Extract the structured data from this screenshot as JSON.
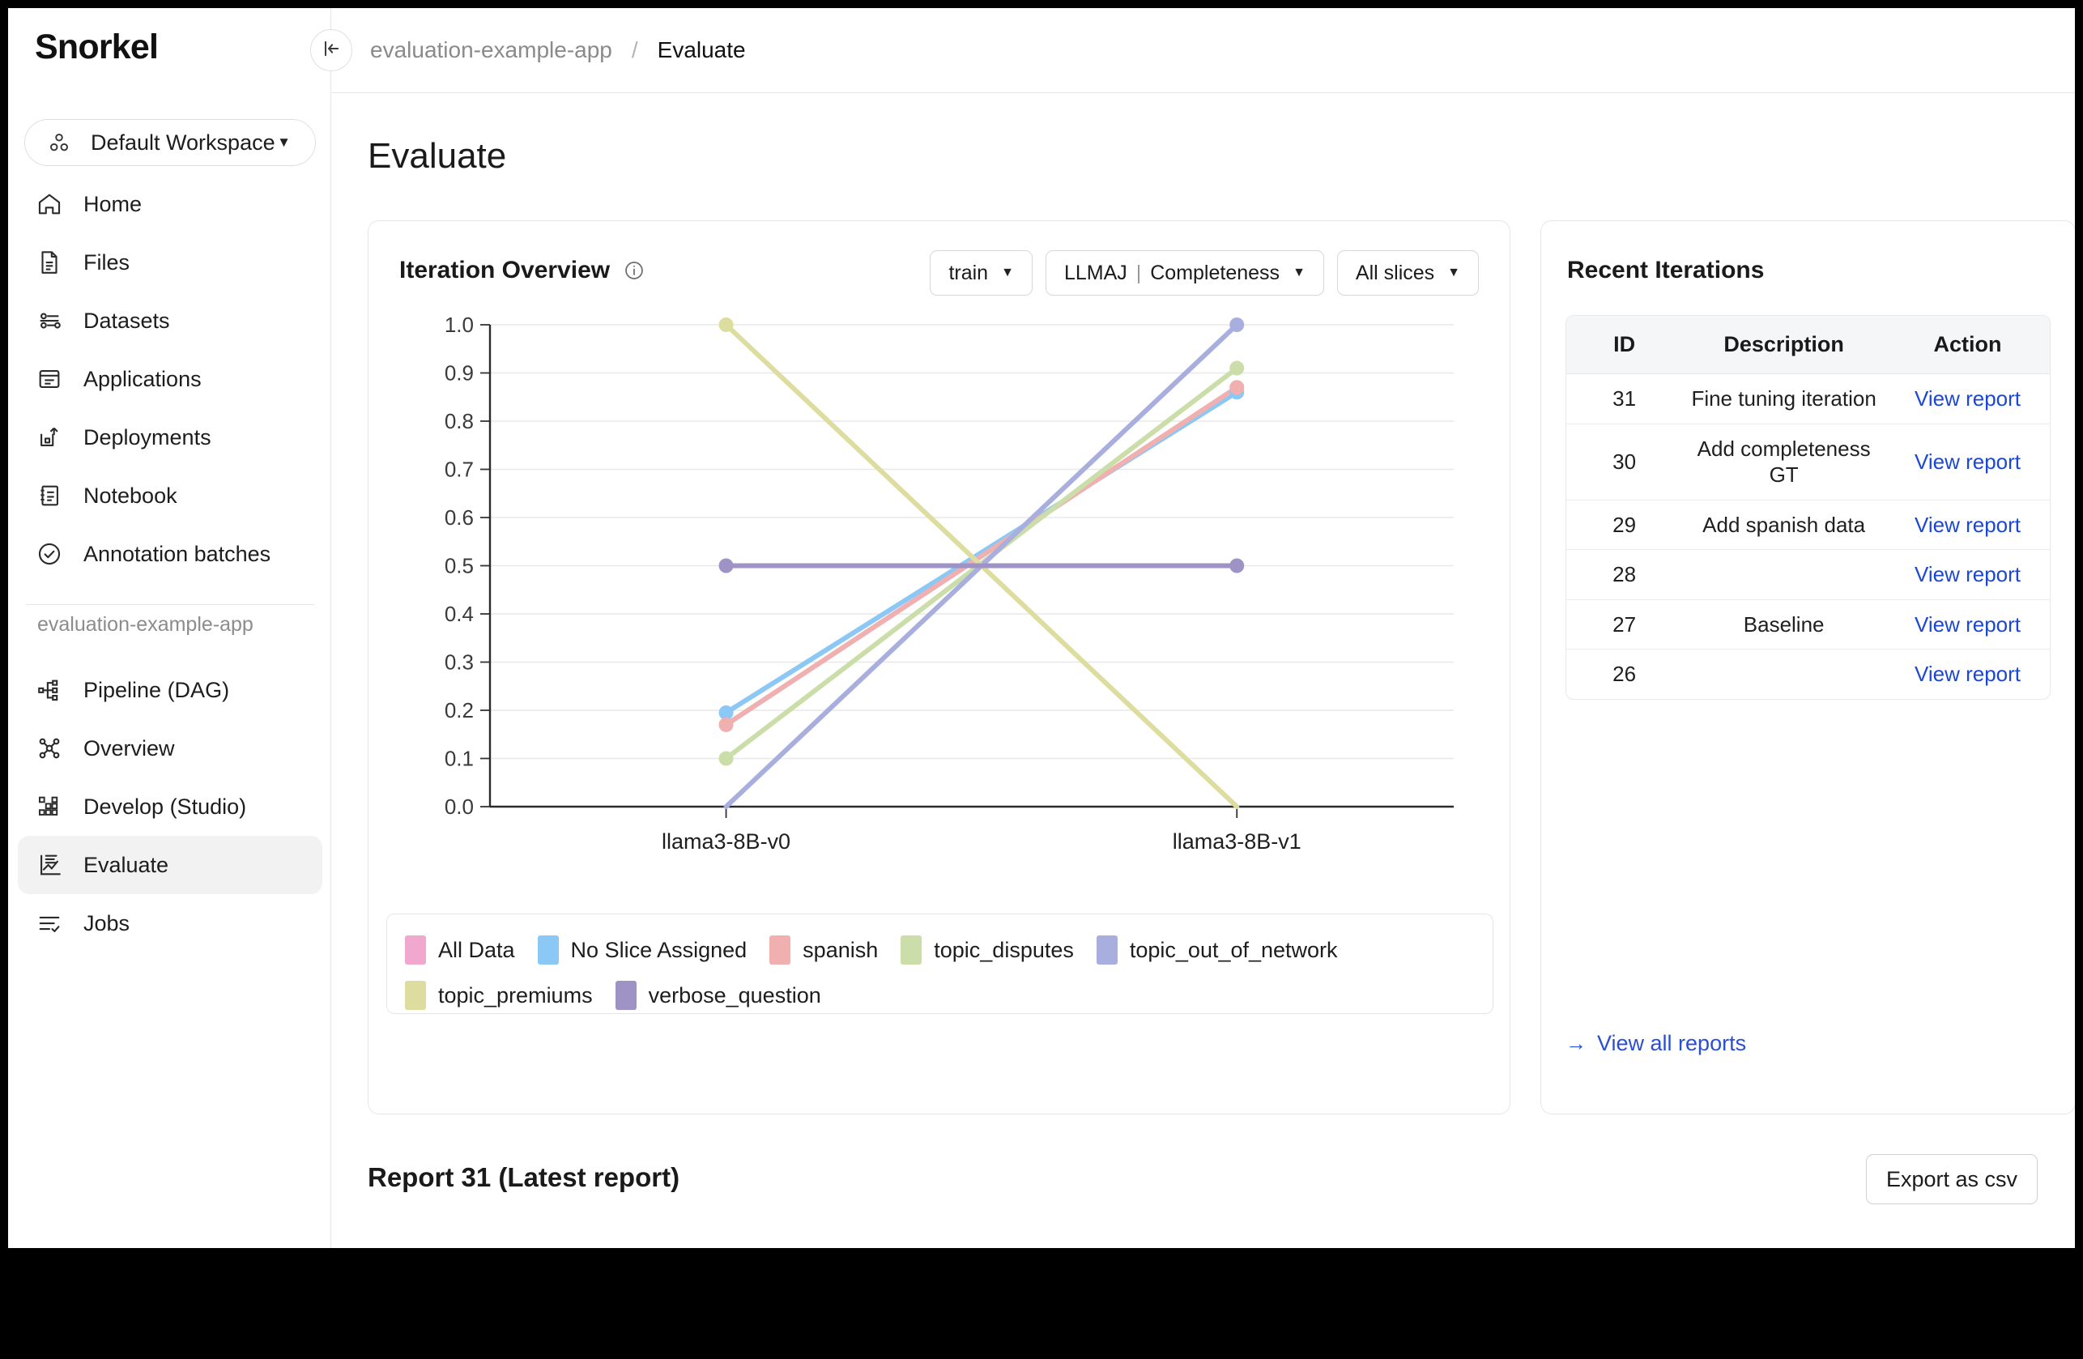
{
  "brand": {
    "name": "Snorkel"
  },
  "workspace": {
    "label": "Default Workspace",
    "caret": "▼",
    "icon": "workspace-dots-icon"
  },
  "sidebar": {
    "items": [
      {
        "label": "Home",
        "icon": "home-icon"
      },
      {
        "label": "Files",
        "icon": "file-icon"
      },
      {
        "label": "Datasets",
        "icon": "datasets-sliders-icon"
      },
      {
        "label": "Applications",
        "icon": "applications-icon"
      },
      {
        "label": "Deployments",
        "icon": "deployments-icon"
      },
      {
        "label": "Notebook",
        "icon": "notebook-icon"
      },
      {
        "label": "Annotation batches",
        "icon": "check-circle-icon"
      }
    ],
    "section_label": "evaluation-example-app",
    "app_items": [
      {
        "label": "Pipeline (DAG)",
        "icon": "dag-icon",
        "active": false
      },
      {
        "label": "Overview",
        "icon": "graph-nodes-icon",
        "active": false
      },
      {
        "label": "Develop (Studio)",
        "icon": "studio-grid-icon",
        "active": false
      },
      {
        "label": "Evaluate",
        "icon": "evaluate-chart-icon",
        "active": true
      },
      {
        "label": "Jobs",
        "icon": "jobs-list-icon",
        "active": false
      }
    ]
  },
  "topbar": {
    "collapse_icon": "collapse-sidebar-icon",
    "breadcrumb_app": "evaluation-example-app",
    "breadcrumb_sep": "/",
    "breadcrumb_page": "Evaluate"
  },
  "page": {
    "title": "Evaluate"
  },
  "chart_card": {
    "title": "Iteration Overview",
    "info_icon": "info-icon",
    "controls": [
      {
        "label": "train",
        "caret": "▼"
      },
      {
        "label": "LLMAJ",
        "label2": "Completeness",
        "sep": "|",
        "caret": "▼"
      },
      {
        "label": "All slices",
        "caret": "▼"
      }
    ]
  },
  "chart_data": {
    "type": "line",
    "title": "Iteration Overview",
    "xlabel": "",
    "ylabel": "",
    "x": [
      "llama3-8B-v0",
      "llama3-8B-v1"
    ],
    "ylim": [
      0.0,
      1.0
    ],
    "yticks": [
      "0.0",
      "0.1",
      "0.2",
      "0.3",
      "0.4",
      "0.5",
      "0.6",
      "0.7",
      "0.8",
      "0.9",
      "1.0"
    ],
    "grid": true,
    "legend_position": "bottom",
    "series": [
      {
        "name": "All Data",
        "color": "#f0a8ce",
        "values": [
          0.17,
          0.87
        ]
      },
      {
        "name": "No Slice Assigned",
        "color": "#8cc8f5",
        "values": [
          0.195,
          0.86
        ]
      },
      {
        "name": "spanish",
        "color": "#f0b0b0",
        "values": [
          0.17,
          0.87
        ]
      },
      {
        "name": "topic_disputes",
        "color": "#cbdda8",
        "values": [
          0.1,
          0.91
        ]
      },
      {
        "name": "topic_out_of_network",
        "color": "#a8aede",
        "values": [
          0.0,
          1.0
        ]
      },
      {
        "name": "topic_premiums",
        "color": "#dedda0",
        "values": [
          1.0,
          0.0
        ]
      },
      {
        "name": "verbose_question",
        "color": "#9e93c4",
        "values": [
          0.5,
          0.5
        ]
      }
    ]
  },
  "iterations": {
    "title": "Recent Iterations",
    "columns": [
      "ID",
      "Description",
      "Action"
    ],
    "rows": [
      {
        "id": "31",
        "description": "Fine tuning iteration",
        "action": "View report"
      },
      {
        "id": "30",
        "description": "Add completeness GT",
        "action": "View report"
      },
      {
        "id": "29",
        "description": "Add spanish data",
        "action": "View report"
      },
      {
        "id": "28",
        "description": "",
        "action": "View report"
      },
      {
        "id": "27",
        "description": "Baseline",
        "action": "View report"
      },
      {
        "id": "26",
        "description": "",
        "action": "View report"
      }
    ],
    "view_all": "View all reports",
    "view_all_arrow": "→"
  },
  "report": {
    "title": "Report 31 (Latest report)",
    "export_label": "Export as csv"
  }
}
